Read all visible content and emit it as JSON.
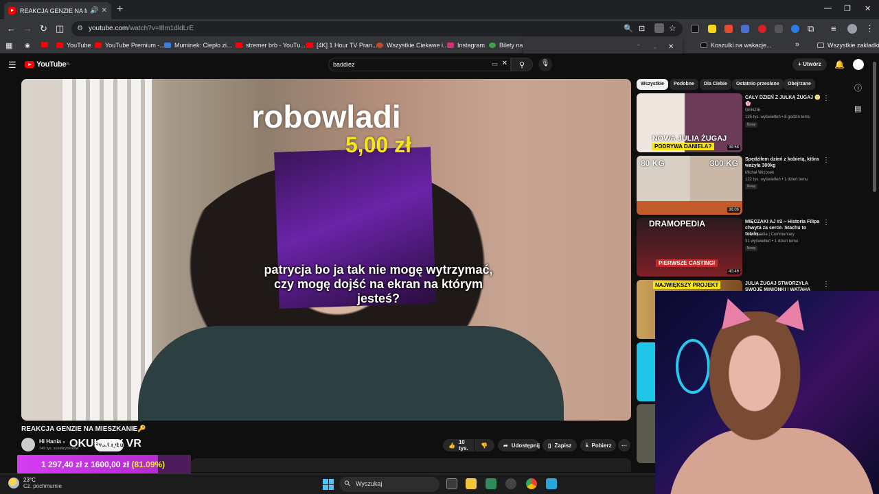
{
  "browser": {
    "tab_title": "REAKCJA GENZIE NA MIESZ",
    "url_host": "youtube.com",
    "url_path": "/watch?v=IIlm1dldLrE",
    "bookmarks": [
      "YouTube",
      "YouTube Premium -...",
      "Muminek: Ciepło zi...",
      "stremer brb - YouTu...",
      "[4K] 1 Hour TV Pran...",
      "Wszystkie Ciekawe i...",
      "Instagram",
      "Bilety na I",
      "Koszulki na wakacje...",
      "Wszystkie zakładki"
    ]
  },
  "youtube": {
    "logo_text": "YouTube",
    "logo_region": "PL",
    "search_value": "baddiez",
    "create_label": "Utwórz",
    "chips": [
      "Wszystkie",
      "Podobne",
      "Dla Ciebie",
      "Ostatnio przesłane",
      "Obejrzane"
    ]
  },
  "video": {
    "overlay_donor": "robowladi",
    "overlay_amount": "5,00 zł",
    "overlay_message": "patrycja bo ja tak nie mogę wytrzymać, czy mogę dojść na ekran na którym jesteś?",
    "title": "REAKCJA GENZIE NA MIESZKANIE🔑",
    "channel": "Hi Hania",
    "subscribers": "749 tys. subskrybentów",
    "subscribe_label": "Subskrybuj",
    "overlay_okulary": "OKULARY VR",
    "likes": "10 tys.",
    "share_label": "Udostępnij",
    "save_label": "Zapisz",
    "download_label": "Pobierz"
  },
  "donation_goal": {
    "current": "1 297,40 zł",
    "separator": "z",
    "target": "1600,00 zł",
    "percent_text": "(81.09%)",
    "progress": 0.8109,
    "fill_color": "#d43df0",
    "bg_color": "#4e1b5b"
  },
  "recommendations": [
    {
      "title": "CAŁY DZIEŃ Z JULKĄ ŻUGAJ 🌝🌸",
      "channel": "GENZIE",
      "meta": "135 tys. wyświetleń • 8 godzin temu",
      "badge": "Nowy",
      "duration": "39:58",
      "thumb_caption_1": "NOWA JULIA ŻUGAJ",
      "thumb_caption_2": "PODRYWA DANIELA?"
    },
    {
      "title": "Spędziłem dzień z kobietą, która ważyła 300kg",
      "channel": "Michał Wrzosek",
      "meta": "122 tys. wyświetleń • 1 dzień temu",
      "badge": "Nowy",
      "duration": "36:06",
      "thumb_caption_1": "80 KG",
      "thumb_caption_2": "300 KG"
    },
    {
      "title": "MIĘCZAKI AJ #2 – Historia Filipa chwyta za serce. Stachu to totaln...",
      "channel": "Dramopedia | Commentary",
      "meta": "31 wyświetleń • 1 dzień temu",
      "badge": "Nowy",
      "duration": "40:46",
      "thumb_caption_1": "DRAMOPEDIA",
      "thumb_caption_2": "PIERWSZE CASTINGI"
    },
    {
      "title": "JULIA ŻUGAJ STWORZYŁA SWOJE MINIONKI | WATAHA LIVE",
      "thumb_caption_1": "NAJWIĘKSZY PROJEKT"
    }
  ],
  "taskbar": {
    "temp": "23°C",
    "weather": "Cz. pochmurnie",
    "search_placeholder": "Wyszukaj"
  },
  "colors": {
    "yt_bg": "#0f0f0f",
    "yt_red": "#ff0000",
    "amount_yellow": "#f7e51a"
  }
}
